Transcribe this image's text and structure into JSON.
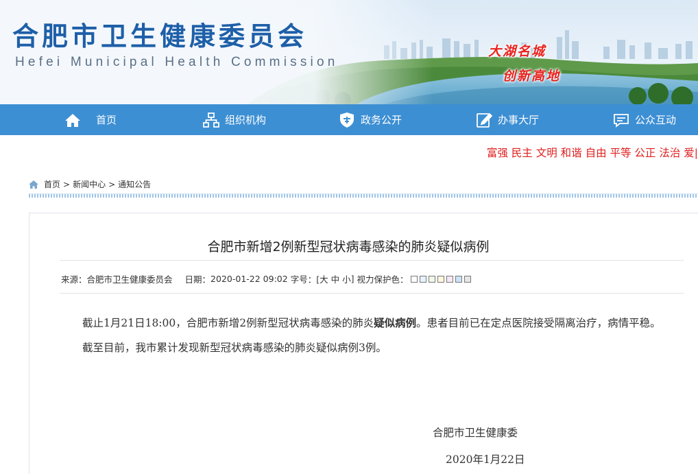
{
  "header": {
    "title": "合肥市卫生健康委员会",
    "subtitle": "Hefei Municipal Health Commission",
    "slogan_line1": "大湖名城",
    "slogan_line2": "创新高地"
  },
  "nav": {
    "items": [
      {
        "label": "首页",
        "icon": "home-icon"
      },
      {
        "label": "组织机构",
        "icon": "org-chart-icon"
      },
      {
        "label": "政务公开",
        "icon": "shield-icon"
      },
      {
        "label": "办事大厅",
        "icon": "edit-icon"
      },
      {
        "label": "公众互动",
        "icon": "chat-icon"
      }
    ]
  },
  "values_bar": "富强 民主 文明 和谐 自由 平等 公正 法治 爱|",
  "breadcrumb": {
    "items": [
      "首页",
      "新闻中心",
      "通知公告"
    ],
    "separator": ">"
  },
  "article": {
    "title": "合肥市新增2例新型冠状病毒感染的肺炎疑似病例",
    "meta": {
      "source_label": "来源：",
      "source": "合肥市卫生健康委员会",
      "date_label": "日期：",
      "date": "2020-01-22 09:02",
      "font_label": "字号：[",
      "font_large": "大",
      "font_medium": "中",
      "font_small": "小",
      "font_end": "]",
      "eye_label": "视力保护色：",
      "swatch_colors": [
        "#ffffff",
        "#e6f2ff",
        "#eef9e8",
        "#fdf9dd",
        "#f7e9f4",
        "#cde3f6",
        "#e6e6e6"
      ]
    },
    "para1_pre": "截止1月21日18:00，合肥市新增2例新型冠状病毒感染的肺炎",
    "para1_bold": "疑似病例",
    "para1_post": "。患者目前已在定点医院接受隔离治疗，病情平稳。",
    "para2": "截至目前，我市累计发现新型冠状病毒感染的肺炎疑似病例3例。",
    "sign_org": "合肥市卫生健康委",
    "sign_date": "2020年1月22日"
  },
  "colors": {
    "nav_bg": "#3d8fd3",
    "title_blue": "#1e5fa8",
    "slogan_red": "#e8231f",
    "values_red": "#e02020"
  }
}
